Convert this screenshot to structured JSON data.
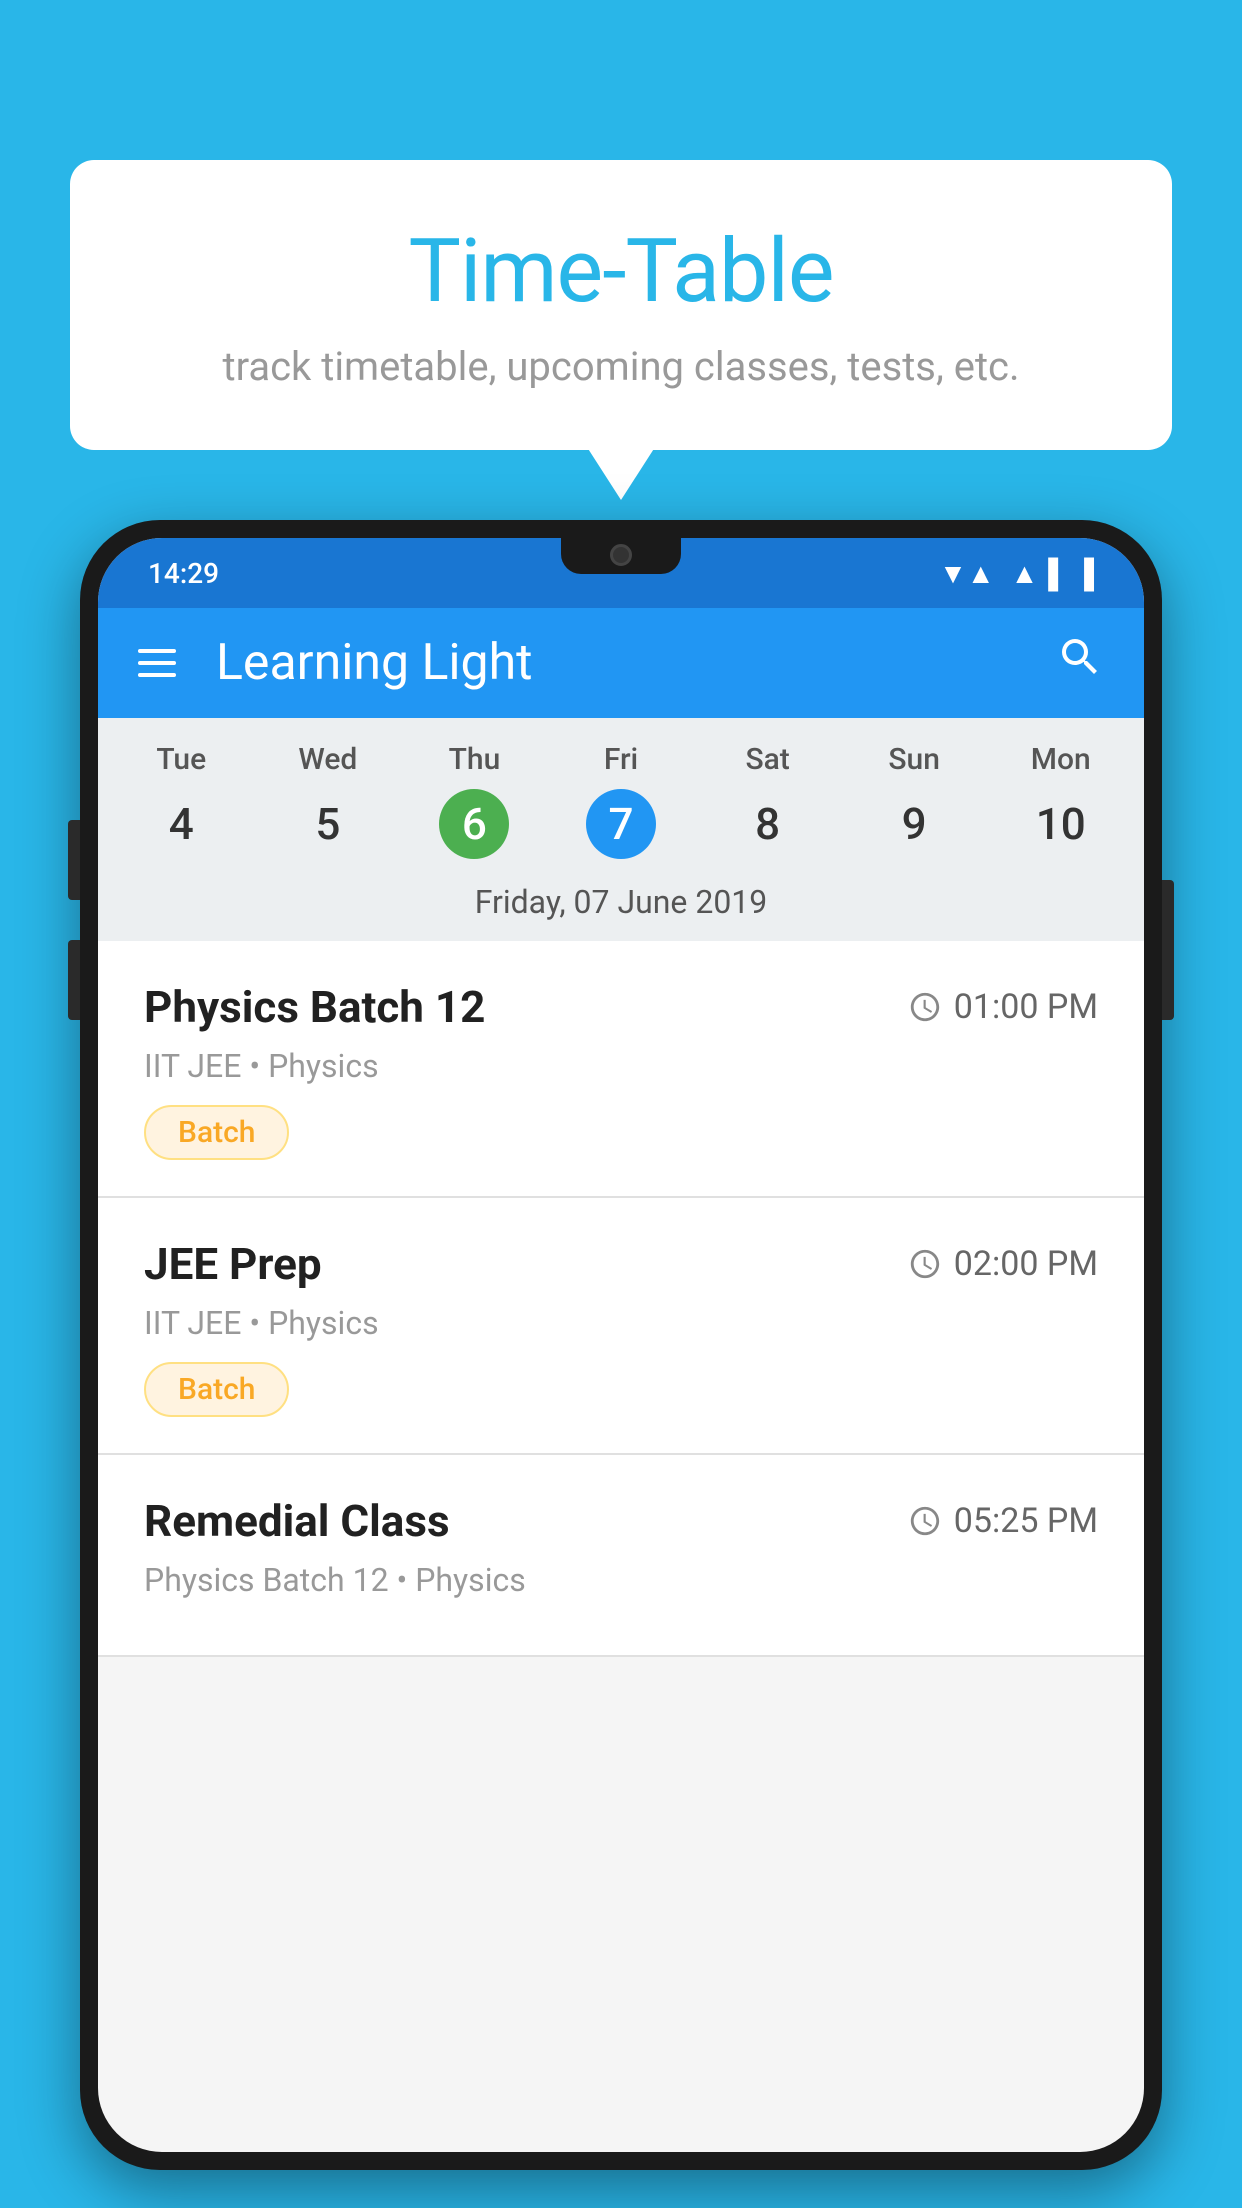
{
  "background_color": "#29b6e8",
  "speech_bubble": {
    "title": "Time-Table",
    "subtitle": "track timetable, upcoming classes, tests, etc."
  },
  "phone": {
    "status_bar": {
      "time": "14:29",
      "wifi": "▼▲",
      "signal": "▲",
      "battery": "▐"
    },
    "app_bar": {
      "title": "Learning Light",
      "menu_icon": "hamburger",
      "search_icon": "search"
    },
    "calendar": {
      "days": [
        {
          "name": "Tue",
          "number": "4",
          "state": "normal"
        },
        {
          "name": "Wed",
          "number": "5",
          "state": "normal"
        },
        {
          "name": "Thu",
          "number": "6",
          "state": "today"
        },
        {
          "name": "Fri",
          "number": "7",
          "state": "selected"
        },
        {
          "name": "Sat",
          "number": "8",
          "state": "normal"
        },
        {
          "name": "Sun",
          "number": "9",
          "state": "normal"
        },
        {
          "name": "Mon",
          "number": "10",
          "state": "normal"
        }
      ],
      "selected_date_label": "Friday, 07 June 2019"
    },
    "classes": [
      {
        "name": "Physics Batch 12",
        "time": "01:00 PM",
        "meta": "IIT JEE • Physics",
        "badge": "Batch"
      },
      {
        "name": "JEE Prep",
        "time": "02:00 PM",
        "meta": "IIT JEE • Physics",
        "badge": "Batch"
      },
      {
        "name": "Remedial Class",
        "time": "05:25 PM",
        "meta": "Physics Batch 12 • Physics",
        "badge": null
      }
    ]
  }
}
